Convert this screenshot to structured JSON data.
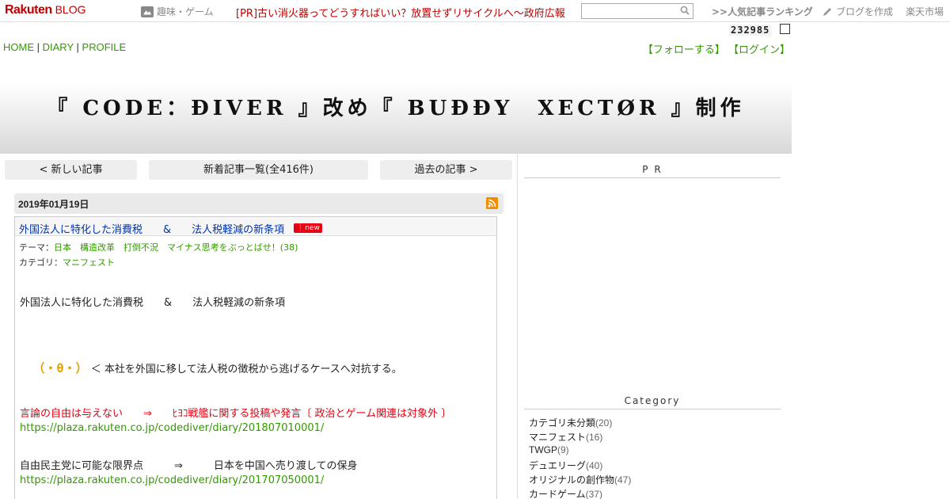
{
  "topbar": {
    "logo_main": "Rakuten",
    "logo_sub": "BLOG",
    "hobby": "趣味・ゲーム",
    "pr_link": "[PR]古い消火器ってどうすればいい？放置せずリサイクルへ～政府広報",
    "search_placeholder": "",
    "ranking": ">>人気記事ランキング",
    "create_blog": "ブログを作成",
    "market": "楽天市場"
  },
  "counter": "232985",
  "nav": {
    "home": "HOME",
    "diary": "DIARY",
    "profile": "PROFILE",
    "sep": "|"
  },
  "follow": "【フォローする】",
  "login": "【ログイン】",
  "banner_title": "『 CODE：ĐIVER 』改め『 BUĐĐY　XECTØR 』制作",
  "pager": {
    "newer": "< 新しい記事",
    "list": "新着記事一覧(全416件)",
    "older": "過去の記事 >"
  },
  "article": {
    "date": "2019年01月19日",
    "title": "外国法人に特化した消費税　　&　　法人税軽減の新条項",
    "new_badge": "new",
    "theme_label": "テーマ：",
    "theme": "日本　構造改革　打倒不況　マイナス思考をぶっとばせ！(38)",
    "category_label": "カテゴリ：",
    "category": "マニフェスト",
    "line1": "外国法人に特化した消費税　　&　　法人税軽減の新条項",
    "emoticon": "（・θ・）",
    "line2": "＜ 本社を外国に移して法人税の徴税から逃げるケースへ対抗する。",
    "line3": "言論の自由は与えない　　⇒　　ﾋﾖｺ戦艦に関する投稿や発言〔 政治とゲーム関連は対象外 〕",
    "link1": "https://plaza.rakuten.co.jp/codediver/diary/201807010001/",
    "line4": "自由民主党に可能な限界点　　　⇒　　　日本を中国へ売り渡しての保身",
    "link2": "https://plaza.rakuten.co.jp/codediver/diary/201707050001/"
  },
  "sidebar": {
    "pr_heading": "P R",
    "category_heading": "Category",
    "categories": [
      {
        "name": "カテゴリ未分類",
        "count": "(20)"
      },
      {
        "name": "マニフェスト",
        "count": "(16)"
      },
      {
        "name": "TWGP",
        "count": "(9)"
      },
      {
        "name": "デュエリーグ",
        "count": "(40)"
      },
      {
        "name": "オリジナルの創作物",
        "count": "(47)"
      },
      {
        "name": "カードゲーム",
        "count": "(37)"
      }
    ]
  },
  "colors": {
    "brand_red": "#bf0000",
    "link_green": "#339900",
    "title_blue": "#0033aa",
    "alert_red": "#e60012"
  }
}
